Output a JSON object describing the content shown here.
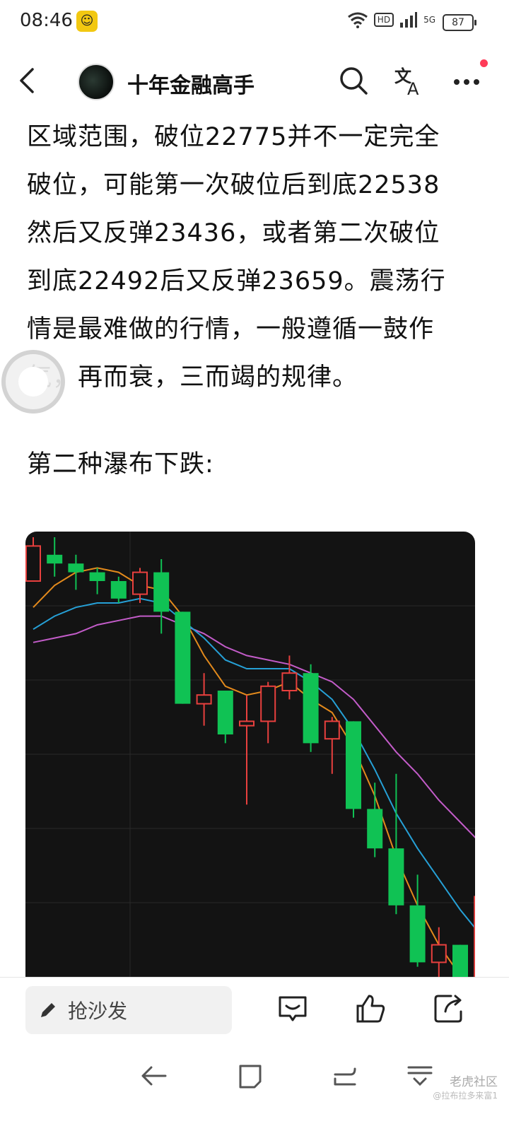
{
  "status_bar": {
    "time": "08:46",
    "network": "HD",
    "signal": "5G",
    "battery": "87"
  },
  "header": {
    "account_name": "十年金融高手",
    "icons": [
      "back-arrow-icon",
      "search-icon",
      "translate-icon",
      "more-icon"
    ]
  },
  "article": {
    "lines": [
      "区域范围，破位22775并不一定完全",
      "破位，可能第一次破位后到底22538",
      "然后又反弹23436，或者第二次破位",
      "到底22492后又反弹23659。震荡行",
      "情是最难做的行情，一般遵循一鼓作",
      "气，再而衰，三而竭的规律。"
    ],
    "subheading": "第二种瀑布下跌:"
  },
  "chart_data": {
    "type": "candlestick",
    "colors": {
      "up": "#e8403e",
      "down": "#10c254",
      "ma_short": "#e38a1c",
      "ma_mid": "#26a0d6",
      "ma_long": "#c35cc9",
      "background": "#131313"
    },
    "candles": [
      {
        "dir": "up",
        "open": 0.1,
        "close": 0.02,
        "high": 0.0,
        "low": 0.1
      },
      {
        "dir": "down",
        "open": 0.04,
        "close": 0.06,
        "high": 0.0,
        "low": 0.09
      },
      {
        "dir": "down",
        "open": 0.06,
        "close": 0.08,
        "high": 0.04,
        "low": 0.12
      },
      {
        "dir": "down",
        "open": 0.08,
        "close": 0.1,
        "high": 0.07,
        "low": 0.13
      },
      {
        "dir": "down",
        "open": 0.1,
        "close": 0.14,
        "high": 0.09,
        "low": 0.15
      },
      {
        "dir": "up",
        "open": 0.13,
        "close": 0.08,
        "high": 0.07,
        "low": 0.15
      },
      {
        "dir": "down",
        "open": 0.08,
        "close": 0.17,
        "high": 0.05,
        "low": 0.22
      },
      {
        "dir": "down",
        "open": 0.17,
        "close": 0.38,
        "high": 0.17,
        "low": 0.38
      },
      {
        "dir": "up",
        "open": 0.38,
        "close": 0.36,
        "high": 0.31,
        "low": 0.43
      },
      {
        "dir": "down",
        "open": 0.35,
        "close": 0.45,
        "high": 0.35,
        "low": 0.47
      },
      {
        "dir": "up",
        "open": 0.43,
        "close": 0.42,
        "high": 0.36,
        "low": 0.61
      },
      {
        "dir": "up",
        "open": 0.42,
        "close": 0.34,
        "high": 0.33,
        "low": 0.47
      },
      {
        "dir": "up",
        "open": 0.35,
        "close": 0.31,
        "high": 0.27,
        "low": 0.37
      },
      {
        "dir": "down",
        "open": 0.31,
        "close": 0.47,
        "high": 0.29,
        "low": 0.49
      },
      {
        "dir": "up",
        "open": 0.46,
        "close": 0.42,
        "high": 0.41,
        "low": 0.54
      },
      {
        "dir": "down",
        "open": 0.42,
        "close": 0.62,
        "high": 0.42,
        "low": 0.64
      },
      {
        "dir": "down",
        "open": 0.62,
        "close": 0.71,
        "high": 0.56,
        "low": 0.73
      },
      {
        "dir": "down",
        "open": 0.71,
        "close": 0.84,
        "high": 0.54,
        "low": 0.86
      },
      {
        "dir": "down",
        "open": 0.84,
        "close": 0.97,
        "high": 0.77,
        "low": 0.98
      },
      {
        "dir": "up",
        "open": 0.97,
        "close": 0.93,
        "high": 0.89,
        "low": 1.02
      },
      {
        "dir": "down",
        "open": 0.93,
        "close": 1.05,
        "high": 0.93,
        "low": 1.05
      },
      {
        "dir": "up",
        "open": 1.05,
        "close": 0.82,
        "high": 0.82,
        "low": 1.05
      }
    ],
    "ma_short": [
      0.16,
      0.11,
      0.08,
      0.07,
      0.08,
      0.11,
      0.12,
      0.18,
      0.27,
      0.34,
      0.36,
      0.35,
      0.33,
      0.37,
      0.4,
      0.48,
      0.59,
      0.73,
      0.84,
      0.93,
      1.0,
      1.05
    ],
    "ma_mid": [
      0.21,
      0.18,
      0.16,
      0.15,
      0.15,
      0.14,
      0.15,
      0.19,
      0.23,
      0.28,
      0.3,
      0.3,
      0.3,
      0.33,
      0.37,
      0.44,
      0.53,
      0.63,
      0.71,
      0.78,
      0.85,
      0.91
    ],
    "ma_long": [
      0.24,
      0.23,
      0.22,
      0.2,
      0.19,
      0.18,
      0.18,
      0.2,
      0.22,
      0.25,
      0.27,
      0.28,
      0.29,
      0.31,
      0.33,
      0.37,
      0.43,
      0.49,
      0.54,
      0.6,
      0.65,
      0.7
    ]
  },
  "bottom_bar": {
    "comment_placeholder": "抢沙发",
    "icons": [
      "comment-icon",
      "like-icon",
      "share-icon"
    ]
  },
  "nav_bar": {
    "watermark_main": "老虎社区",
    "watermark_sub": "@拉布拉多来富1"
  }
}
